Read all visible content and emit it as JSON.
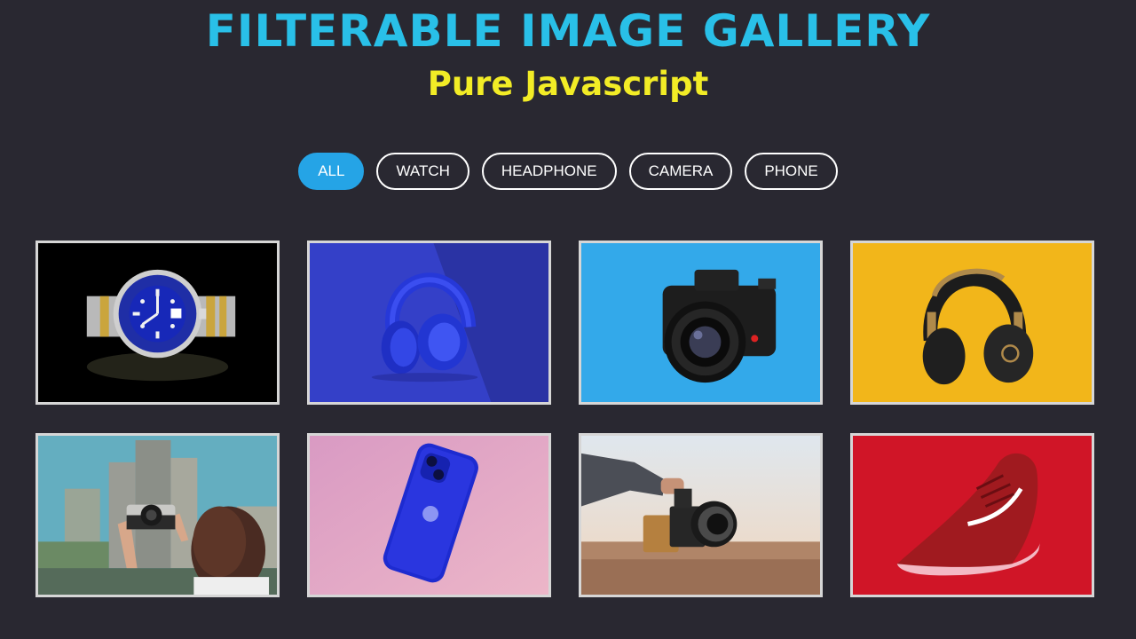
{
  "header": {
    "title": "FILTERABLE IMAGE GALLERY",
    "subtitle": "Pure Javascript"
  },
  "filters": [
    {
      "label": "ALL",
      "active": true
    },
    {
      "label": "WATCH",
      "active": false
    },
    {
      "label": "HEADPHONE",
      "active": false
    },
    {
      "label": "CAMERA",
      "active": false
    },
    {
      "label": "PHONE",
      "active": false
    }
  ],
  "gallery": {
    "items": [
      {
        "subject": "watch",
        "background": "#000000"
      },
      {
        "subject": "headphone",
        "background": "#3440c8"
      },
      {
        "subject": "camera",
        "background": "#33a9ea"
      },
      {
        "subject": "headphone",
        "background": "#f2b61a"
      },
      {
        "subject": "camera",
        "background": "#5fa7b8"
      },
      {
        "subject": "phone",
        "background": "#e2a0c4"
      },
      {
        "subject": "camera",
        "background": "#c9b7a9"
      },
      {
        "subject": "shoe",
        "background": "#d01527"
      }
    ]
  },
  "colors": {
    "page_background": "#292831",
    "title": "#29c0e8",
    "subtitle": "#f2ec26",
    "active_filter": "#25a4e6",
    "card_border": "#d6d6d6"
  }
}
